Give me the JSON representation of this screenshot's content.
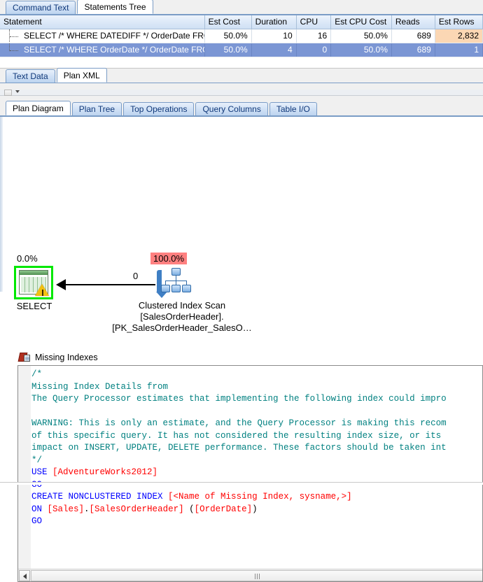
{
  "top_tabs": [
    {
      "label": "Command Text",
      "active": false
    },
    {
      "label": "Statements Tree",
      "active": true
    }
  ],
  "grid": {
    "columns": [
      "Statement",
      "Est Cost",
      "Duration",
      "CPU",
      "Est CPU Cost",
      "Reads",
      "Est Rows"
    ],
    "rows": [
      {
        "selected": false,
        "statement": "SELECT /* WHERE DATEDIFF */ OrderDate FROM …",
        "est_cost": "50.0%",
        "duration": "10",
        "cpu": "16",
        "est_cpu_cost": "50.0%",
        "reads": "689",
        "est_rows": "2,832",
        "est_rows_highlight": true
      },
      {
        "selected": true,
        "statement": "SELECT /* WHERE OrderDate */ OrderDate FROM …",
        "est_cost": "50.0%",
        "duration": "4",
        "cpu": "0",
        "est_cpu_cost": "50.0%",
        "reads": "689",
        "est_rows": "1",
        "est_rows_highlight": false
      }
    ]
  },
  "xml_tabs": [
    {
      "label": "Text Data",
      "active": false
    },
    {
      "label": "Plan XML",
      "active": true
    }
  ],
  "plan_tabs": [
    {
      "label": "Plan Diagram",
      "active": true
    },
    {
      "label": "Plan Tree",
      "active": false
    },
    {
      "label": "Top Operations",
      "active": false
    },
    {
      "label": "Query Columns",
      "active": false
    },
    {
      "label": "Table I/O",
      "active": false
    }
  ],
  "diagram": {
    "select_node": {
      "cost_pct": "0.0%",
      "label": "SELECT",
      "icon": "select-result-icon",
      "warning": true,
      "highlight_color": "#00e800"
    },
    "scan_node": {
      "cost_pct": "100.0%",
      "badge_color": "#ff8080",
      "icon": "clustered-index-scan-icon",
      "label_line1": "Clustered Index Scan",
      "label_line2": "[SalesOrderHeader].",
      "label_line3": "[PK_SalesOrderHeader_SalesO…"
    },
    "arrow_value": "0"
  },
  "missing_indexes": {
    "title": "Missing Indexes",
    "icon": "missing-index-icon",
    "code_lines": [
      [
        {
          "t": "/*",
          "c": "comment"
        }
      ],
      [
        {
          "t": "Missing Index Details from",
          "c": "comment"
        }
      ],
      [
        {
          "t": "The Query Processor estimates that implementing the following index could impro",
          "c": "comment"
        }
      ],
      [
        {
          "t": "",
          "c": "comment"
        }
      ],
      [
        {
          "t": "WARNING: This is only an estimate, and the Query Processor is making this recom",
          "c": "comment"
        }
      ],
      [
        {
          "t": "of this specific query. It has not considered the resulting index size, or its",
          "c": "comment"
        }
      ],
      [
        {
          "t": "impact on INSERT, UPDATE, DELETE performance. These factors should be taken int",
          "c": "comment"
        }
      ],
      [
        {
          "t": "*/",
          "c": "comment"
        }
      ],
      [
        {
          "t": "USE ",
          "c": "kw"
        },
        {
          "t": "[AdventureWorks2012]",
          "c": "id"
        }
      ],
      [
        {
          "t": "GO",
          "c": "kw"
        }
      ],
      [
        {
          "t": "CREATE NONCLUSTERED INDEX ",
          "c": "kw"
        },
        {
          "t": "[<Name of Missing Index, sysname,>]",
          "c": "id"
        }
      ],
      [
        {
          "t": "ON ",
          "c": "kw"
        },
        {
          "t": "[Sales]",
          "c": "id"
        },
        {
          "t": ".",
          "c": "plain"
        },
        {
          "t": "[SalesOrderHeader]",
          "c": "id"
        },
        {
          "t": " (",
          "c": "plain"
        },
        {
          "t": "[OrderDate]",
          "c": "id"
        },
        {
          "t": ")",
          "c": "plain"
        }
      ],
      [
        {
          "t": "GO",
          "c": "kw"
        }
      ]
    ]
  }
}
